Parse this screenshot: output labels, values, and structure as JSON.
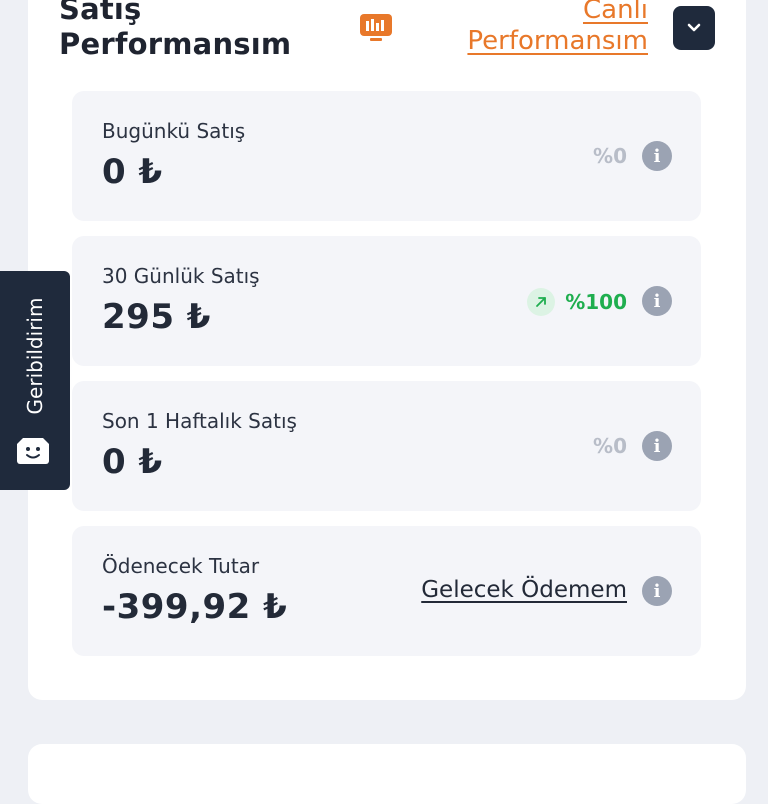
{
  "header": {
    "title": "Satış Performansım",
    "live_link": "Canlı Performansım",
    "live_icon": "live-monitor-icon",
    "collapse_icon": "chevron-down-icon"
  },
  "cards": [
    {
      "label": "Bugünkü Satış",
      "value": "0 ₺",
      "change": "%0",
      "trend": "neutral"
    },
    {
      "label": "30 Günlük Satış",
      "value": "295 ₺",
      "change": "%100",
      "trend": "up"
    },
    {
      "label": "Son 1 Haftalık Satış",
      "value": "0 ₺",
      "change": "%0",
      "trend": "neutral"
    },
    {
      "label": "Ödenecek Tutar",
      "value": "-399,92 ₺",
      "link": "Gelecek Ödemem"
    }
  ],
  "info_glyph": "i",
  "feedback": {
    "label": "Geribildirim",
    "icon": "smiley-face-icon"
  },
  "colors": {
    "accent": "#e8782a",
    "dark": "#1f2a3c",
    "positive": "#1fae4f",
    "muted": "#b8bdc8"
  }
}
